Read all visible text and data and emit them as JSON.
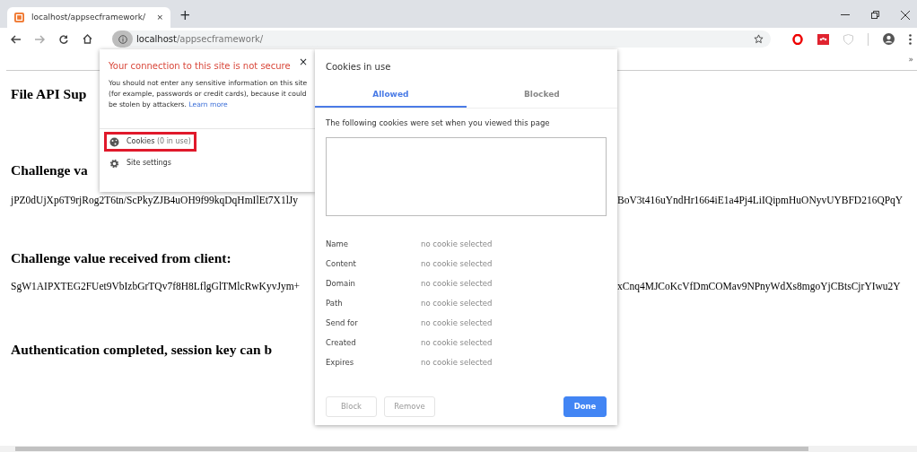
{
  "browser": {
    "tab": {
      "title": "localhost/appsecframework/",
      "close": "×"
    },
    "new_tab": "+",
    "address": {
      "host": "localhost",
      "path": "/appsecframework/"
    },
    "bookmarks_more": "»"
  },
  "page": {
    "lines": [
      {
        "kind": "heading",
        "left": "File API Sup"
      },
      {
        "kind": "heading",
        "left": "Challenge va"
      },
      {
        "kind": "text",
        "left": "jPZ0dUjXp6T9rjRog2T6tn/ScPkyZJB4uOH9f99kqDqHmIlEt7X1lJy",
        "right": "BoV3t416uYndHr1664iE1a4Pj4LiIQipmHuONyvUYBFD216QPqY"
      },
      {
        "kind": "heading",
        "left": "Challenge value received from client:"
      },
      {
        "kind": "text",
        "left": "SgW1AIPXTEG2FUet9VbIzbGrTQv7f8H8LflgGlTMlcRwKyvJym+",
        "right": "xCnq4MJCoKcVfDmCOMav9NPnyWdXs8mgoYjCBtsCjrYIwu2Y"
      },
      {
        "kind": "heading",
        "left": "Authentication completed, session key can b"
      }
    ]
  },
  "site_info": {
    "title": "Your connection to this site is not secure",
    "close": "×",
    "body": "You should not enter any sensitive information on this site (for example, passwords or credit cards), because it could be stolen by attackers.",
    "link": "Learn more",
    "items": [
      {
        "kind": "cookies",
        "label": "Cookies",
        "detail": "(0 in use)",
        "highlighted": true
      },
      {
        "kind": "settings",
        "label": "Site settings",
        "highlighted": false
      }
    ]
  },
  "cookies_dialog": {
    "title": "Cookies in use",
    "tabs": [
      {
        "label": "Allowed",
        "selected": true
      },
      {
        "label": "Blocked",
        "selected": false
      }
    ],
    "description": "The following cookies were set when you viewed this page",
    "fields": [
      {
        "label": "Name",
        "value": "no cookie selected"
      },
      {
        "label": "Content",
        "value": "no cookie selected"
      },
      {
        "label": "Domain",
        "value": "no cookie selected"
      },
      {
        "label": "Path",
        "value": "no cookie selected"
      },
      {
        "label": "Send for",
        "value": "no cookie selected"
      },
      {
        "label": "Created",
        "value": "no cookie selected"
      },
      {
        "label": "Expires",
        "value": "no cookie selected"
      }
    ],
    "buttons": [
      {
        "label": "Block",
        "kind": "secondary",
        "disabled": true
      },
      {
        "label": "Remove",
        "kind": "secondary",
        "disabled": true
      },
      {
        "label": "Done",
        "kind": "primary",
        "disabled": false
      }
    ]
  }
}
